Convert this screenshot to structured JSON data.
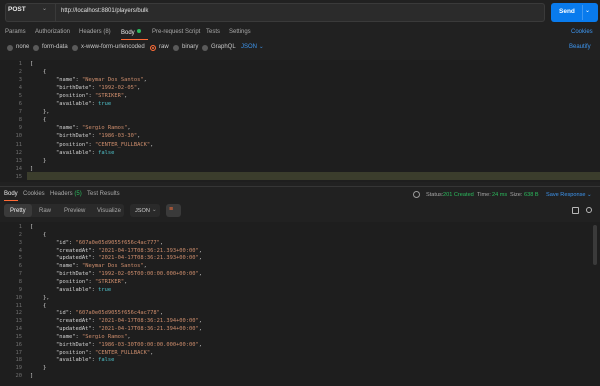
{
  "request": {
    "method": "POST",
    "url": "http://localhost:8801/players/bulk",
    "send_label": "Send"
  },
  "request_tabs": [
    {
      "label": "Params"
    },
    {
      "label": "Authorization"
    },
    {
      "label": "Headers (8)"
    },
    {
      "label": "Body"
    },
    {
      "label": "Pre-request Script"
    },
    {
      "label": "Tests"
    },
    {
      "label": "Settings"
    }
  ],
  "cookies_label": "Cookies",
  "body_types": [
    {
      "label": "none"
    },
    {
      "label": "form-data"
    },
    {
      "label": "x-www-form-urlencoded"
    },
    {
      "label": "raw"
    },
    {
      "label": "binary"
    },
    {
      "label": "GraphQL"
    }
  ],
  "body_format": "JSON",
  "beautify_label": "Beautify",
  "request_body_lines": [
    "[",
    "    {",
    "        \"name\": \"Neymar Dos Santos\",",
    "        \"birthDate\": \"1992-02-05\",",
    "        \"position\": \"STRIKER\",",
    "        \"available\": true",
    "    },",
    "    {",
    "        \"name\": \"Sergio Ramos\",",
    "        \"birthDate\": \"1986-03-30\",",
    "        \"position\": \"CENTER_FULLBACK\",",
    "        \"available\": false",
    "    }",
    "]",
    ""
  ],
  "response_tabs": [
    {
      "label": "Body"
    },
    {
      "label": "Cookies"
    },
    {
      "label": "Headers (5)"
    },
    {
      "label": "Test Results"
    }
  ],
  "response_status": {
    "status_label": "Status:",
    "status_value": "201 Created",
    "time_label": "Time:",
    "time_value": "24 ms",
    "size_label": "Size:",
    "size_value": "638 B",
    "save_label": "Save Response"
  },
  "view_tabs": [
    {
      "label": "Pretty"
    },
    {
      "label": "Raw"
    },
    {
      "label": "Preview"
    },
    {
      "label": "Visualize"
    }
  ],
  "response_format": "JSON",
  "response_body_lines": [
    "[",
    "    {",
    "        \"id\": \"607a0e05d9055f656c4ac777\",",
    "        \"createdAt\": \"2021-04-17T08:36:21.393+00:00\",",
    "        \"updatedAt\": \"2021-04-17T08:36:21.393+00:00\",",
    "        \"name\": \"Neymar Dos Santos\",",
    "        \"birthDate\": \"1992-02-05T00:00:00.000+00:00\",",
    "        \"position\": \"STRIKER\",",
    "        \"available\": true",
    "    },",
    "    {",
    "        \"id\": \"607a0e05d9055f656c4ac778\",",
    "        \"createdAt\": \"2021-04-17T08:36:21.394+00:00\",",
    "        \"updatedAt\": \"2021-04-17T08:36:21.394+00:00\",",
    "        \"name\": \"Sergio Ramos\",",
    "        \"birthDate\": \"1986-03-30T00:00:00.000+00:00\",",
    "        \"position\": \"CENTER_FULLBACK\",",
    "        \"available\": false",
    "    }",
    "]"
  ]
}
